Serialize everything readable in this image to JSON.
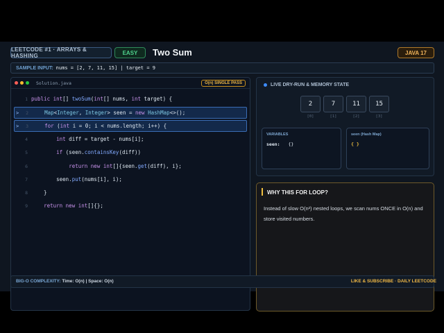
{
  "header": {
    "tag": "LEETCODE #1 · ARRAYS & HASHING",
    "difficulty": "EASY",
    "title": "Two Sum",
    "language": "JAVA 17"
  },
  "sample": {
    "label": "SAMPLE INPUT:",
    "value": "nums = [2, 7, 11, 15]  |  target = 9"
  },
  "editor": {
    "filename": "Solution.java",
    "badge": "O(n) SINGLE PASS",
    "lines": [
      {
        "n": "1",
        "arrow": "",
        "code": "public int[] twoSum(int[] nums, int target) {"
      },
      {
        "n": "2",
        "arrow": ">",
        "code": "    Map<Integer, Integer> seen = new HashMap<>();"
      },
      {
        "n": "3",
        "arrow": ">",
        "code": "    for (int i = 0; i < nums.length; i++) {"
      },
      {
        "n": "4",
        "arrow": "",
        "code": "        int diff = target - nums[i];"
      },
      {
        "n": "5",
        "arrow": "",
        "code": "        if (seen.containsKey(diff))"
      },
      {
        "n": "6",
        "arrow": "",
        "code": "            return new int[]{seen.get(diff), i};"
      },
      {
        "n": "7",
        "arrow": "",
        "code": "        seen.put(nums[i], i);"
      },
      {
        "n": "8",
        "arrow": "",
        "code": "    }"
      },
      {
        "n": "9",
        "arrow": "",
        "code": "    return new int[]{};"
      }
    ]
  },
  "dryrun": {
    "title": "LIVE DRY-RUN & MEMORY STATE",
    "array": [
      "2",
      "7",
      "11",
      "15"
    ],
    "indices": [
      "[0]",
      "[1]",
      "[2]",
      "[3]"
    ],
    "variables_title": "VARIABLES",
    "variables_key": "seen:",
    "variables_value": "{}",
    "hashmap_title": "seen (Hash Map)",
    "hashmap_value": "{ }"
  },
  "why": {
    "title": "WHY THIS FOR LOOP?",
    "body": "Instead of slow O(n²) nested loops, we scan nums ONCE in O(n) and store visited numbers."
  },
  "footer": {
    "complexity_label": "BIG-O COMPLEXITY:",
    "time": "Time: O(n)",
    "space": "Space: O(n)",
    "cta": "LIKE & SUBSCRIBE · DAILY LEETCODE"
  },
  "colors": {
    "accent": "#3d8bfd",
    "highlight": "#f0b845",
    "easy": "#4fd18c"
  }
}
